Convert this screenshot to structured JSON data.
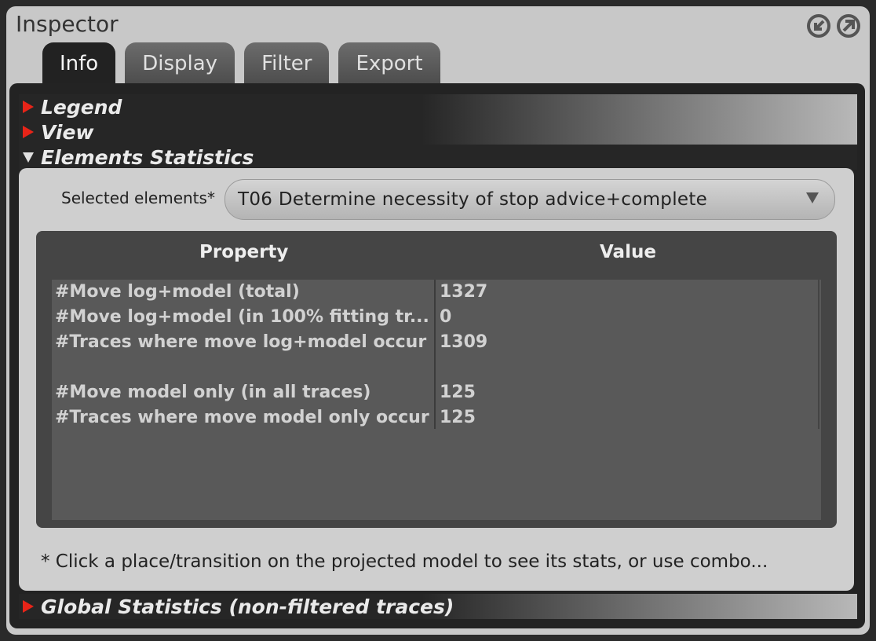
{
  "window": {
    "title": "Inspector"
  },
  "tabs": [
    {
      "label": "Info",
      "active": true
    },
    {
      "label": "Display",
      "active": false
    },
    {
      "label": "Filter",
      "active": false
    },
    {
      "label": "Export",
      "active": false
    }
  ],
  "sections": {
    "legend": "Legend",
    "view": "View",
    "elements_statistics": "Elements Statistics",
    "global_statistics": "Global Statistics (non-filtered traces)"
  },
  "selected": {
    "label": "Selected elements*",
    "value": "T06 Determine necessity of stop advice+complete"
  },
  "table": {
    "headers": {
      "property": "Property",
      "value": "Value"
    },
    "rows": [
      {
        "property": "#Move log+model (total)",
        "value": "1327"
      },
      {
        "property": "#Move log+model (in 100% fitting tr...",
        "value": "0"
      },
      {
        "property": "#Traces where move log+model occur",
        "value": "1309"
      },
      {
        "property": "",
        "value": ""
      },
      {
        "property": "#Move model only (in all traces)",
        "value": "125"
      },
      {
        "property": "#Traces where move model only occur",
        "value": "125"
      }
    ]
  },
  "footnote": "* Click a place/transition on the projected model to see its stats, or use combo...",
  "icons": [
    "collapse-icon",
    "detach-icon",
    "expand-arrow-icon",
    "collapse-arrow-icon",
    "dropdown-arrow-icon"
  ],
  "colors": {
    "expand_arrow": "#e82418",
    "panel": "#232323",
    "window": "#c8c8c8"
  }
}
